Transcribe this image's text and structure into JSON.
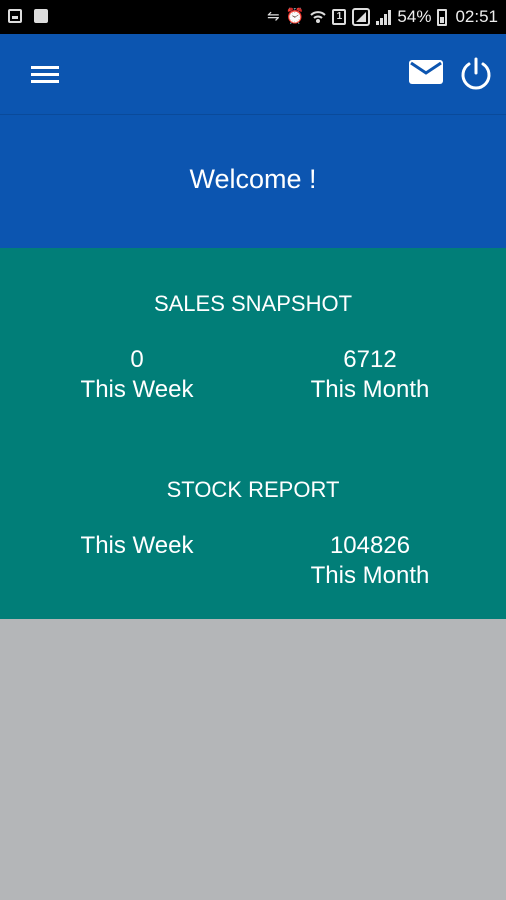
{
  "status_bar": {
    "battery_percent": "54%",
    "time": "02:51",
    "sim_label": "1",
    "icons": [
      "image-notification-icon",
      "message-notification-icon",
      "vibrate-icon",
      "alarm-icon",
      "wifi-icon",
      "sim-icon",
      "signal-icon",
      "battery-icon"
    ]
  },
  "app_bar": {
    "icons": [
      "menu-icon",
      "mail-icon",
      "power-icon"
    ]
  },
  "welcome": {
    "text": "Welcome !"
  },
  "sales_snapshot": {
    "title": "SALES SNAPSHOT",
    "week_value": "0",
    "week_label": "This Week",
    "month_value": "6712",
    "month_label": "This Month"
  },
  "stock_report": {
    "title": "STOCK REPORT",
    "week_value": "",
    "week_label": "This Week",
    "month_value": "104826",
    "month_label": "This Month"
  },
  "colors": {
    "app_bar": "#0c55b0",
    "dashboard": "#017e78",
    "background": "#b4b6b8"
  }
}
